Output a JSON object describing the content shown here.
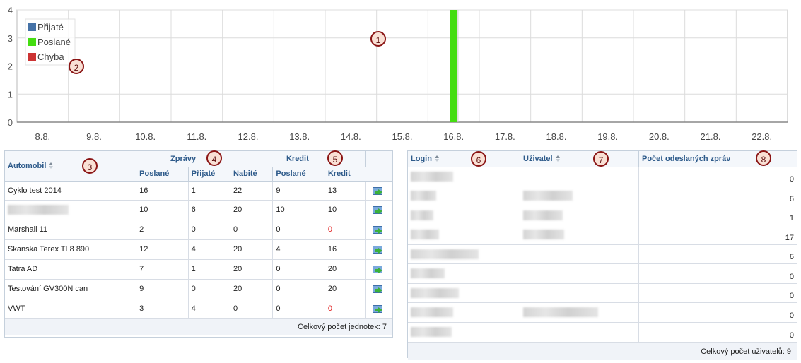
{
  "chart_data": {
    "type": "bar",
    "categories": [
      "8.8.",
      "9.8.",
      "10.8.",
      "11.8.",
      "12.8.",
      "13.8.",
      "14.8.",
      "15.8.",
      "16.8.",
      "17.8.",
      "18.8.",
      "19.8.",
      "20.8.",
      "21.8.",
      "22.8."
    ],
    "series": [
      {
        "name": "Přijaté",
        "color": "#4572a7",
        "values": [
          0,
          0,
          0,
          0,
          0,
          0,
          0,
          0,
          0,
          0,
          0,
          0,
          0,
          0,
          0
        ]
      },
      {
        "name": "Poslané",
        "color": "#44dd11",
        "values": [
          0,
          0,
          0,
          0,
          0,
          0,
          0,
          0,
          4,
          0,
          0,
          0,
          0,
          0,
          0
        ]
      },
      {
        "name": "Chyba",
        "color": "#cc3333",
        "values": [
          0,
          0,
          0,
          0,
          0,
          0,
          0,
          0,
          0,
          0,
          0,
          0,
          0,
          0,
          0
        ]
      }
    ],
    "yticks": [
      "0",
      "1",
      "2",
      "3",
      "4"
    ],
    "ylim": [
      0,
      4
    ],
    "grid": true,
    "legend": "top-left"
  },
  "callouts": [
    "1",
    "2",
    "3",
    "4",
    "5",
    "6",
    "7",
    "8"
  ],
  "vehicles": {
    "headers": {
      "automobil": "Automobil",
      "zpravy": "Zprávy",
      "kredit_group": "Kredit",
      "poslane": "Poslané",
      "prijate": "Přijaté",
      "nabite": "Nabité",
      "poslane2": "Poslané",
      "kredit": "Kredit"
    },
    "rows": [
      {
        "name": "Cyklo test 2014",
        "poslane": "16",
        "prijate": "1",
        "nabite": "22",
        "poslane2": "9",
        "kredit": "13",
        "negative": false
      },
      {
        "name": "",
        "poslane": "10",
        "prijate": "6",
        "nabite": "20",
        "poslane2": "10",
        "kredit": "10",
        "negative": false
      },
      {
        "name": "Marshall 11",
        "poslane": "2",
        "prijate": "0",
        "nabite": "0",
        "poslane2": "0",
        "kredit": "0",
        "negative": true
      },
      {
        "name": "Skanska Terex TL8 890",
        "poslane": "12",
        "prijate": "4",
        "nabite": "20",
        "poslane2": "4",
        "kredit": "16",
        "negative": false
      },
      {
        "name": "Tatra AD",
        "poslane": "7",
        "prijate": "1",
        "nabite": "20",
        "poslane2": "0",
        "kredit": "20",
        "negative": false
      },
      {
        "name": "Testování GV300N can",
        "poslane": "9",
        "prijate": "0",
        "nabite": "20",
        "poslane2": "0",
        "kredit": "20",
        "negative": false
      },
      {
        "name": "VWT",
        "poslane": "3",
        "prijate": "4",
        "nabite": "0",
        "poslane2": "0",
        "kredit": "0",
        "negative": true
      }
    ],
    "footer": "Celkový počet jednotek: 7"
  },
  "users": {
    "headers": {
      "login": "Login",
      "uzivatel": "Uživatel",
      "pocet": "Počet odeslaných zpráv"
    },
    "rows": [
      {
        "count": "0"
      },
      {
        "count": "6"
      },
      {
        "count": "1"
      },
      {
        "count": "17"
      },
      {
        "count": "6"
      },
      {
        "count": "0"
      },
      {
        "count": "0"
      },
      {
        "count": "0"
      },
      {
        "count": "0"
      }
    ],
    "footer": "Celkový počet uživatelů: 9"
  }
}
